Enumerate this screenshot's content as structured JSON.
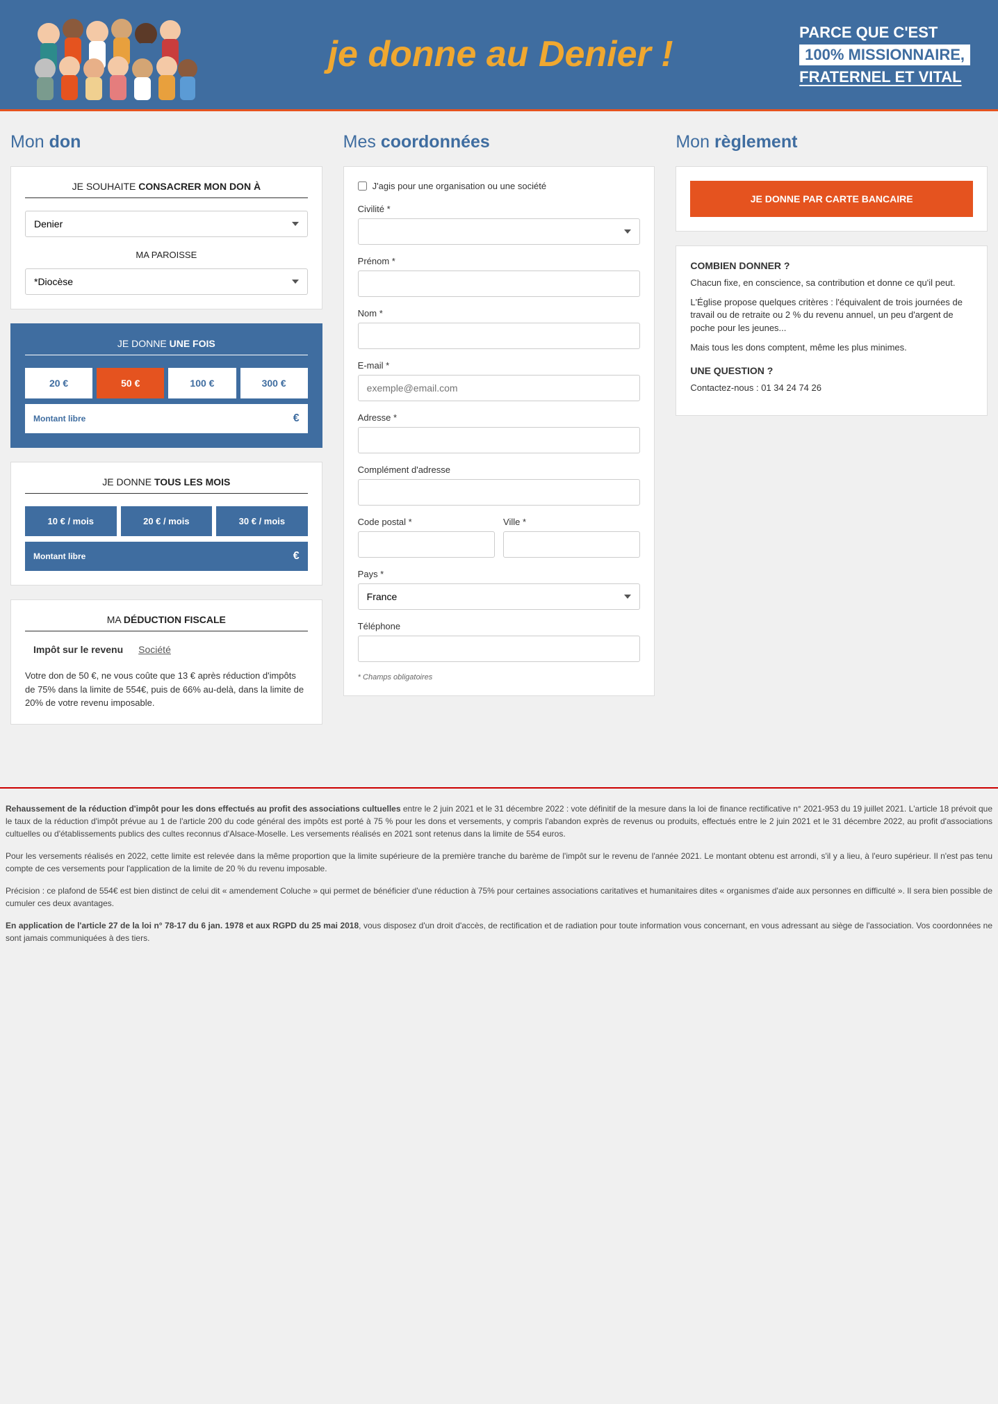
{
  "banner": {
    "title": "je donne au Denier !",
    "right1": "PARCE QUE C'EST",
    "right2": "100% MISSIONNAIRE,",
    "right3": "FRATERNEL ET VITAL"
  },
  "don": {
    "heading_pre": "Mon ",
    "heading_bold": "don",
    "dedicate_pre": "JE SOUHAITE ",
    "dedicate_bold": "CONSACRER MON DON À",
    "target_selected": "Denier",
    "parish_label": "MA PAROISSE",
    "parish_selected": "*Diocèse",
    "once_pre": "JE DONNE ",
    "once_bold": "UNE FOIS",
    "amounts": [
      "20 €",
      "50 €",
      "100 €",
      "300 €"
    ],
    "amount_free": "Montant libre",
    "currency": "€",
    "monthly_pre": "JE DONNE ",
    "monthly_bold": "TOUS LES MOIS",
    "monthly_amounts": [
      "10 € / mois",
      "20 € / mois",
      "30 € / mois"
    ],
    "fiscal_pre": "MA ",
    "fiscal_bold": "DÉDUCTION FISCALE",
    "fiscal_tab1": "Impôt sur le revenu",
    "fiscal_tab2": "Société",
    "fiscal_text": "Votre don de 50 €, ne vous coûte que 13 € après réduction d'impôts de 75% dans la limite de 554€, puis de 66% au-delà, dans la limite de 20% de votre revenu imposable."
  },
  "coord": {
    "heading_pre": "Mes ",
    "heading_bold": "coordonnées",
    "org_label": "J'agis pour une organisation ou une société",
    "civ": "Civilité *",
    "prenom": "Prénom *",
    "nom": "Nom *",
    "email": "E-mail *",
    "email_ph": "exemple@email.com",
    "adresse": "Adresse *",
    "complement": "Complément d'adresse",
    "cp": "Code postal *",
    "ville": "Ville *",
    "pays": "Pays *",
    "pays_selected": "France",
    "tel": "Téléphone",
    "required": "* Champs obligatoires"
  },
  "reglement": {
    "heading_pre": "Mon ",
    "heading_bold": "règlement",
    "submit": "JE DONNE PAR CARTE BANCAIRE",
    "q1_h": "COMBIEN DONNER ?",
    "q1_p1": "Chacun fixe, en conscience, sa contribution et donne ce qu'il peut.",
    "q1_p2": "L'Église propose quelques critères : l'équivalent de trois journées de travail ou de retraite ou 2 % du revenu annuel, un peu d'argent de poche pour les jeunes...",
    "q1_p3": "Mais tous les dons comptent, même les plus minimes.",
    "q2_h": "UNE QUESTION ?",
    "q2_p": "Contactez-nous : 01 34 24 74 26"
  },
  "legal": {
    "p1_b": "Rehaussement de la réduction d'impôt pour les dons effectués au profit des associations cultuelles",
    "p1": " entre le 2 juin 2021 et le 31 décembre 2022 : vote définitif de la mesure dans la loi de finance rectificative n° 2021-953 du 19 juillet 2021. L'article 18 prévoit que le taux de la réduction d'impôt prévue au 1 de l'article 200 du code général des impôts est porté à 75 % pour les dons et versements, y compris l'abandon exprès de revenus ou produits, effectués entre le 2 juin 2021 et le 31 décembre 2022, au profit d'associations cultuelles ou d'établissements publics des cultes reconnus d'Alsace-Moselle. Les versements réalisés en 2021 sont retenus dans la limite de 554 euros.",
    "p2": "Pour les versements réalisés en 2022, cette limite est relevée dans la même proportion que la limite supérieure de la première tranche du barème de l'impôt sur le revenu de l'année 2021. Le montant obtenu est arrondi, s'il y a lieu, à l'euro supérieur. Il n'est pas tenu compte de ces versements pour l'application de la limite de 20 % du revenu imposable.",
    "p3": "Précision : ce plafond de 554€ est bien distinct de celui dit « amendement Coluche » qui permet de bénéficier d'une réduction à 75% pour certaines associations caritatives et humanitaires dites « organismes d'aide aux personnes en difficulté ». Il sera bien possible de cumuler ces deux avantages.",
    "p4_b": "En application de l'article 27 de la loi n° 78-17 du 6 jan. 1978 et aux RGPD du 25 mai 2018",
    "p4": ", vous disposez d'un droit d'accès, de rectification et de radiation pour toute information vous concernant, en vous adressant au siège de l'association. Vos coordonnées ne sont jamais communiquées à des tiers."
  }
}
